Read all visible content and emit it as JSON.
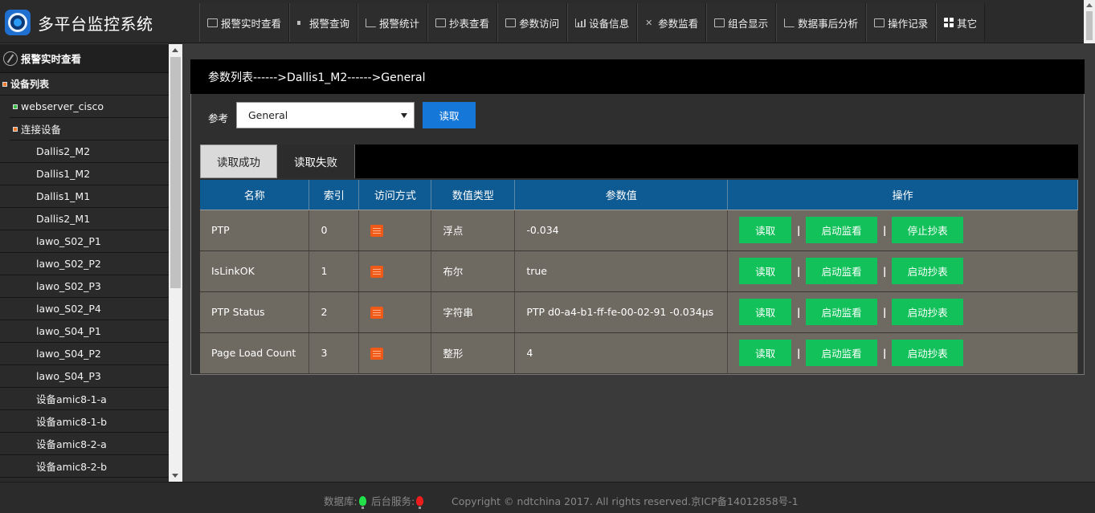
{
  "app": {
    "title": "多平台监控系统"
  },
  "nav": {
    "items": [
      {
        "label": "报警实时查看",
        "icon": "monitor-icon"
      },
      {
        "label": "报警查询",
        "icon": "speaker-icon"
      },
      {
        "label": "报警统计",
        "icon": "line-chart-icon"
      },
      {
        "label": "抄表查看",
        "icon": "meter-icon"
      },
      {
        "label": "参数访问",
        "icon": "panel-icon"
      },
      {
        "label": "设备信息",
        "icon": "bar-chart-icon"
      },
      {
        "label": "参数监看",
        "icon": "tools-icon"
      },
      {
        "label": "组合显示",
        "icon": "combo-icon"
      },
      {
        "label": "数据事后分析",
        "icon": "analysis-icon"
      },
      {
        "label": "操作记录",
        "icon": "list-icon"
      },
      {
        "label": "其它",
        "icon": "grid-icon"
      }
    ]
  },
  "sidebar": {
    "header": "报警实时查看",
    "device_list_label": "设备列表",
    "server": "webserver_cisco",
    "connected_label": "连接设备",
    "devices": [
      "Dallis2_M2",
      "Dallis1_M2",
      "Dallis1_M1",
      "Dallis2_M1",
      "lawo_S02_P1",
      "lawo_S02_P2",
      "lawo_S02_P3",
      "lawo_S02_P4",
      "lawo_S04_P1",
      "lawo_S04_P2",
      "lawo_S04_P3",
      "设备amic8-1-a",
      "设备amic8-1-b",
      "设备amic8-2-a",
      "设备amic8-2-b"
    ]
  },
  "main": {
    "breadcrumb": "参数列表------>Dallis1_M2------>General",
    "ref_label": "参考",
    "select_value": "General",
    "read_button": "读取",
    "tabs": [
      "读取成功",
      "读取失败"
    ],
    "columns": [
      "名称",
      "索引",
      "访问方式",
      "数值类型",
      "参数值",
      "操作"
    ],
    "rows": [
      {
        "name": "PTP",
        "index": "0",
        "type": "浮点",
        "value": "-0.034",
        "op1": "读取",
        "op2": "启动监看",
        "op3": "停止抄表"
      },
      {
        "name": "IsLinkOK",
        "index": "1",
        "type": "布尔",
        "value": "true",
        "op1": "读取",
        "op2": "启动监看",
        "op3": "启动抄表"
      },
      {
        "name": "PTP Status",
        "index": "2",
        "type": "字符串",
        "value": "PTP d0-a4-b1-ff-fe-00-02-91 -0.034µs",
        "op1": "读取",
        "op2": "启动监看",
        "op3": "启动抄表"
      },
      {
        "name": "Page Load Count",
        "index": "3",
        "type": "整形",
        "value": "4",
        "op1": "读取",
        "op2": "启动监看",
        "op3": "启动抄表"
      }
    ],
    "separator": "|"
  },
  "footer": {
    "db_label": "数据库:",
    "service_label": "后台服务:",
    "copyright": "Copyright © ndtchina 2017. All rights reserved.京ICP备14012858号-1"
  },
  "colors": {
    "accent_blue": "#1577d8",
    "header_blue": "#0e5a92",
    "button_green": "#12c15a",
    "access_orange": "#f05a18"
  }
}
